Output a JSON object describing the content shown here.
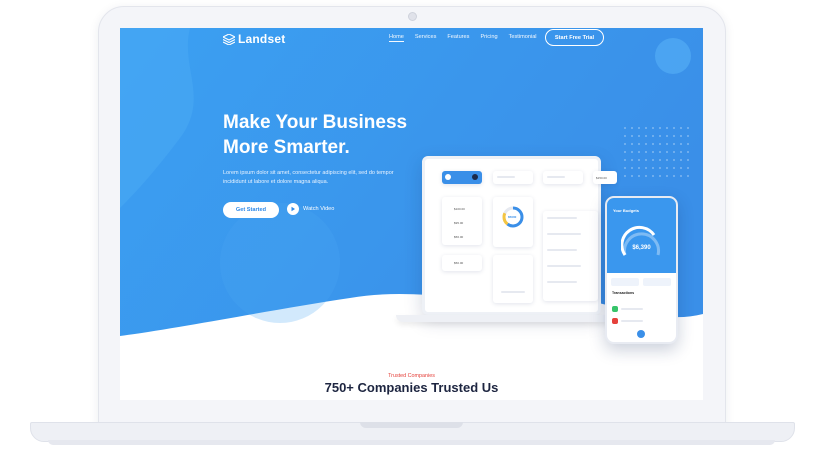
{
  "nav": {
    "logo_text": "Landset",
    "links": [
      "Home",
      "Services",
      "Features",
      "Pricing",
      "Testimonial"
    ],
    "cta_label": "Start Free Trial"
  },
  "hero": {
    "headline_line1": "Make Your Business",
    "headline_line2": "More Smarter.",
    "subtext_line1": "Lorem ipsum dolor sit amet, consectetur adipiscing elit, sed do tempor",
    "subtext_line2": "incididunt ut labore et dolore magna aliqua.",
    "primary_button": "Get Started",
    "secondary_button": "Watch Video"
  },
  "mockup": {
    "dashboard": {
      "chip_amounts": [
        "$150.00",
        "$100.00",
        "$95.00",
        "$56.00",
        "$50.00"
      ],
      "donut_value": "$5000"
    },
    "phone": {
      "title": "Your Budgets",
      "amount": "$6,390",
      "transactions_label": "Transactions"
    }
  },
  "trusted": {
    "kicker": "Trusted Companies",
    "title": "750+ Companies Trusted Us"
  },
  "colors": {
    "hero_blue": "#3b9cf0",
    "hero_blue_light": "#55b2f7",
    "accent_red": "#e5413b",
    "title_dark": "#1d2540"
  }
}
